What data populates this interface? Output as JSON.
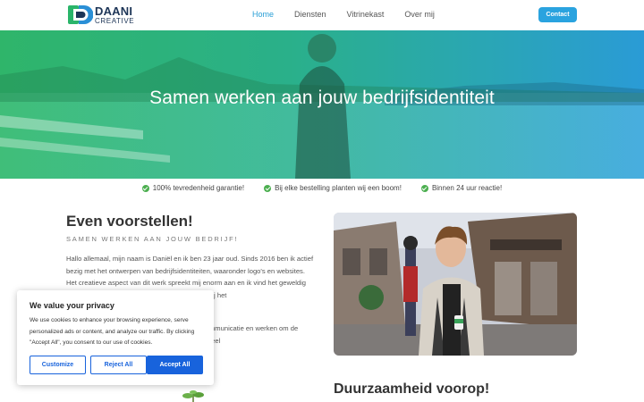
{
  "brand": {
    "name": "DAANI",
    "sub": "CREATIVE"
  },
  "nav": {
    "items": [
      "Home",
      "Diensten",
      "Vitrinekast",
      "Over mij"
    ],
    "active": "Home"
  },
  "header": {
    "contact_label": "Contact"
  },
  "hero": {
    "title": "Samen werken aan jouw bedrijfsidentiteit"
  },
  "usps": [
    "100% tevredenheid garantie!",
    "Bij elke bestelling planten wij een boom!",
    "Binnen 24 uur reactie!"
  ],
  "intro": {
    "title": "Even voorstellen!",
    "subtitle": "SAMEN WERKEN AAN JOUW BEDRIJF!",
    "p1": "Hallo allemaal, mijn naam is Daniël en ik ben 23 jaar oud. Sinds 2016 ben ik actief bezig met het ontwerpen van bedrijfsidentiteiten, waaronder logo's en websites. Het creatieve aspect van dit werk spreekt mij enorm aan en ik vind het geweldig om samen te werken en om anderen te helpen bij het",
    "p2": "Mijn passie ligt bij het ontwerpen van visuele communicatie en werken om de ideeën van mijn klanten om te zetten in een visueel"
  },
  "section2": {
    "title": "Duurzaamheid voorop!"
  },
  "cookie": {
    "title": "We value your privacy",
    "text": "We use cookies to enhance your browsing experience, serve personalized ads or content, and analyze our traffic. By clicking \"Accept All\", you consent to our use of cookies.",
    "customize": "Customize",
    "reject": "Reject All",
    "accept": "Accept All"
  },
  "colors": {
    "accent": "#2aa3df",
    "hero_green": "#2fb56a",
    "hero_blue": "#2a9bd6",
    "cookie_blue": "#1863dc",
    "check": "#4caf50"
  }
}
